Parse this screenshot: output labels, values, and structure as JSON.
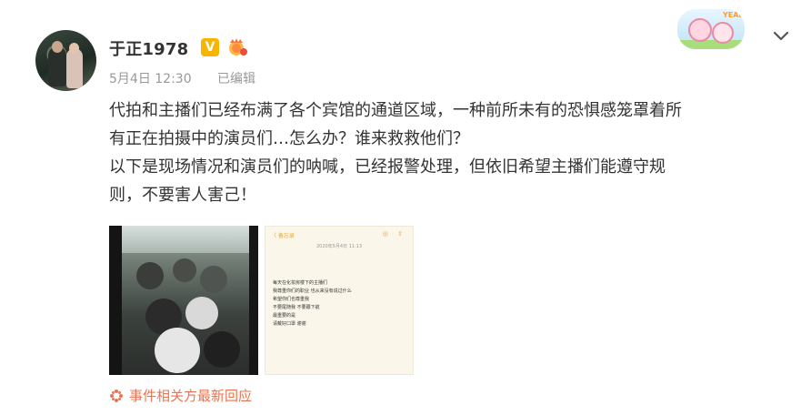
{
  "author": {
    "name": "于正1978",
    "vip_badge": "V",
    "avatar_icon": "avatar"
  },
  "meta": {
    "date": "5月4日 12:30",
    "edited": "已编辑"
  },
  "post": {
    "lines": [
      "代拍和主播们已经布满了各个宾馆的通道区域，一种前所未有的恐惧感笼罩着所",
      "有正在拍摄中的演员们…怎么办？谁来救救他们？",
      "以下是现场情况和演员们的呐喊，已经报警处理，但依旧希望主播们能遵守规",
      "则，不要害人害己！"
    ]
  },
  "mascot": {
    "text": "YEAH!"
  },
  "memo": {
    "back": "〈 备忘录",
    "date": "2020年5月4日 11:13",
    "lines": [
      "每天在化妆房楼下的主播们",
      "我尊重你们的职业 也从来没有说过什么",
      "希望你们也尊重我",
      "不要尾随我 不要跟下航",
      "最重要的是",
      "请戴好口罩 谢谢"
    ]
  },
  "footer": {
    "link_text": "事件相关方最新回应"
  },
  "colors": {
    "accent": "#eb7350",
    "vip": "#f7b500",
    "meta_text": "#999999",
    "body_text": "#333333"
  }
}
